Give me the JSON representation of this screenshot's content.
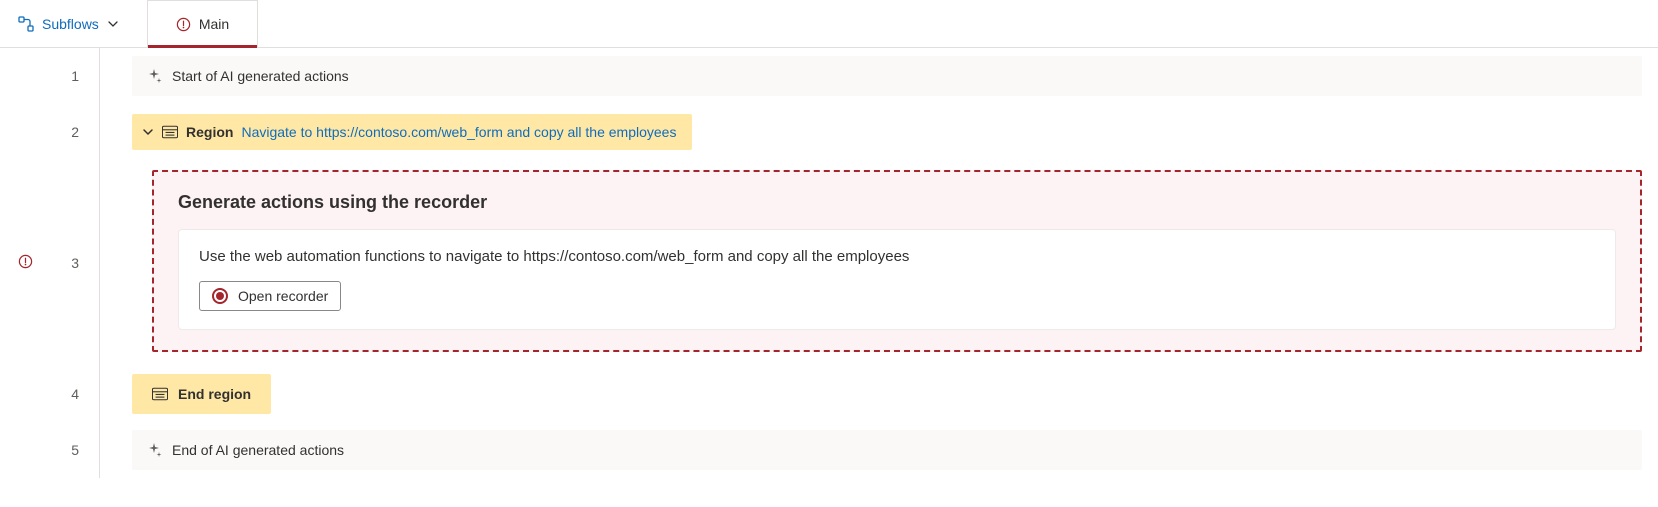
{
  "topbar": {
    "subflows_label": "Subflows",
    "main_tab_label": "Main"
  },
  "rows": {
    "r1": {
      "num": "1",
      "text": "Start of AI generated actions"
    },
    "r2": {
      "num": "2",
      "region_label": "Region",
      "region_desc": "Navigate to https://contoso.com/web_form and copy all the employees"
    },
    "r3": {
      "num": "3",
      "title": "Generate actions using the recorder",
      "body": "Use the web automation functions to navigate to https://contoso.com/web_form and copy all the employees",
      "button": "Open recorder"
    },
    "r4": {
      "num": "4",
      "text": "End region"
    },
    "r5": {
      "num": "5",
      "text": "End of AI generated actions"
    }
  }
}
